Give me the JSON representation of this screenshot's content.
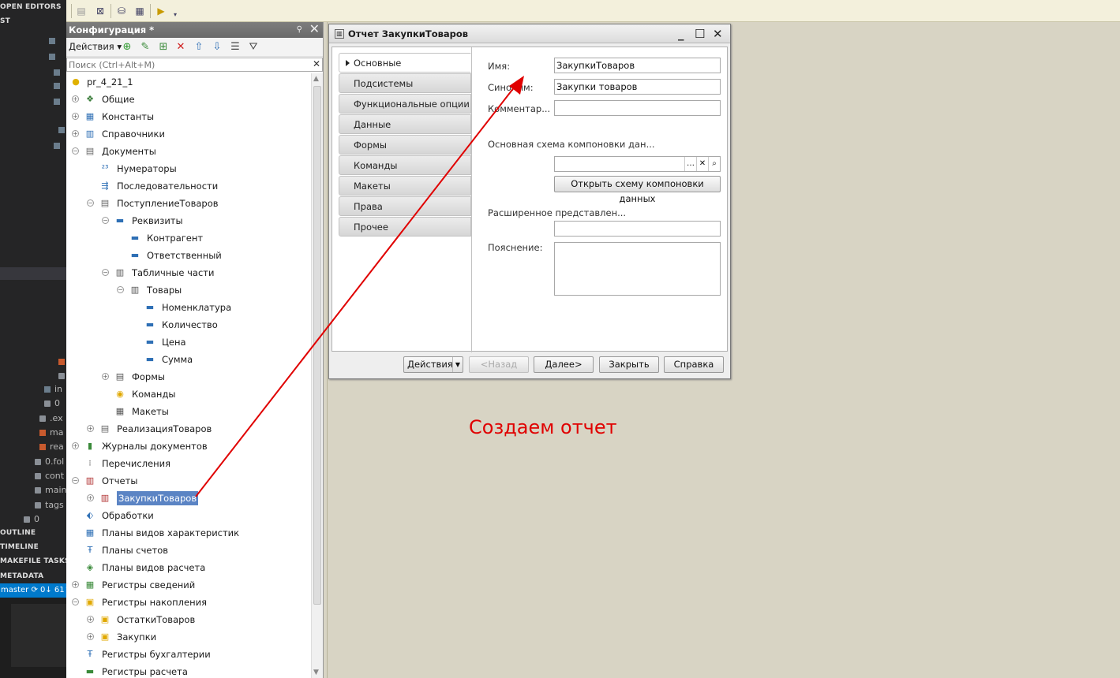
{
  "vscode": {
    "header_open_editors": "OPEN EDITORS",
    "header_st": "ST",
    "files": [
      "in",
      "0",
      ".ex",
      "ma",
      "rea",
      "0.fol",
      "cont",
      "main",
      "tags",
      "0"
    ],
    "outline": "OUTLINE",
    "timeline": "TIMELINE",
    "makefile_tasks": "MAKEFILE TASKS",
    "metadata": "METADATA",
    "status": "master ⟳ 0↓ 61↑"
  },
  "config": {
    "title": "Конфигурация *",
    "actions_label": "Действия ▾",
    "search_placeholder": "Поиск (Ctrl+Alt+M)",
    "tree": [
      {
        "label": "pr_4_21_1",
        "icon": "config-root-icon",
        "glyph": "●",
        "color": "#e0b100"
      },
      {
        "label": "Общие",
        "icon": "common-icon",
        "glyph": "❖",
        "color": "#3a7d3a",
        "exp": "+"
      },
      {
        "label": "Константы",
        "icon": "constants-icon",
        "glyph": "▦",
        "color": "#2e6fb5",
        "exp": "+"
      },
      {
        "label": "Справочники",
        "icon": "catalogs-icon",
        "glyph": "▥",
        "color": "#2e6fb5",
        "exp": "+"
      },
      {
        "label": "Документы",
        "icon": "documents-icon",
        "glyph": "▤",
        "color": "#666",
        "exp": "−"
      },
      {
        "label": "Нумераторы",
        "icon": "numerators-icon",
        "glyph": "²³",
        "color": "#2e6fb5"
      },
      {
        "label": "Последовательности",
        "icon": "sequences-icon",
        "glyph": "⇶",
        "color": "#2e6fb5"
      },
      {
        "label": "ПоступлениеТоваров",
        "icon": "document-icon",
        "glyph": "▤",
        "color": "#666",
        "exp": "−"
      },
      {
        "label": "Реквизиты",
        "icon": "attributes-icon",
        "glyph": "▬",
        "color": "#2e6fb5",
        "exp": "−"
      },
      {
        "label": "Контрагент",
        "icon": "attribute-icon",
        "glyph": "▬",
        "color": "#2e6fb5"
      },
      {
        "label": "Ответственный",
        "icon": "attribute-icon",
        "glyph": "▬",
        "color": "#2e6fb5"
      },
      {
        "label": "Табличные части",
        "icon": "tabular-sections-icon",
        "glyph": "▥",
        "color": "#555",
        "exp": "−"
      },
      {
        "label": "Товары",
        "icon": "tabular-section-icon",
        "glyph": "▥",
        "color": "#555",
        "exp": "−"
      },
      {
        "label": "Номенклатура",
        "icon": "attribute-icon",
        "glyph": "▬",
        "color": "#2e6fb5"
      },
      {
        "label": "Количество",
        "icon": "attribute-icon",
        "glyph": "▬",
        "color": "#2e6fb5"
      },
      {
        "label": "Цена",
        "icon": "attribute-icon",
        "glyph": "▬",
        "color": "#2e6fb5"
      },
      {
        "label": "Сумма",
        "icon": "attribute-icon",
        "glyph": "▬",
        "color": "#2e6fb5"
      },
      {
        "label": "Формы",
        "icon": "forms-icon",
        "glyph": "▤",
        "color": "#555",
        "exp": "+"
      },
      {
        "label": "Команды",
        "icon": "commands-icon",
        "glyph": "◉",
        "color": "#e0a800"
      },
      {
        "label": "Макеты",
        "icon": "templates-icon",
        "glyph": "▦",
        "color": "#555"
      },
      {
        "label": "РеализацияТоваров",
        "icon": "document-icon",
        "glyph": "▤",
        "color": "#666",
        "exp": "+"
      },
      {
        "label": "Журналы документов",
        "icon": "journals-icon",
        "glyph": "▮",
        "color": "#3a8a3a",
        "exp": "+"
      },
      {
        "label": "Перечисления",
        "icon": "enums-icon",
        "glyph": "⁝",
        "color": "#555"
      },
      {
        "label": "Отчеты",
        "icon": "reports-icon",
        "glyph": "▥",
        "color": "#b03030",
        "exp": "−"
      },
      {
        "label": "ЗакупкиТоваров",
        "icon": "report-icon",
        "glyph": "▥",
        "color": "#b03030",
        "exp": "+",
        "selected": true
      },
      {
        "label": "Обработки",
        "icon": "data-processors-icon",
        "glyph": "⬖",
        "color": "#2e6fb5"
      },
      {
        "label": "Планы видов характеристик",
        "icon": "chart-of-characteristics-icon",
        "glyph": "▦",
        "color": "#2e6fb5"
      },
      {
        "label": "Планы счетов",
        "icon": "chart-of-accounts-icon",
        "glyph": "Ŧ",
        "color": "#2e6fb5"
      },
      {
        "label": "Планы видов расчета",
        "icon": "chart-of-calculation-icon",
        "glyph": "◈",
        "color": "#3a8a3a"
      },
      {
        "label": "Регистры сведений",
        "icon": "info-registers-icon",
        "glyph": "▦",
        "color": "#3a8a3a",
        "exp": "+"
      },
      {
        "label": "Регистры накопления",
        "icon": "accumulation-registers-icon",
        "glyph": "▣",
        "color": "#e0a800",
        "exp": "−"
      },
      {
        "label": "ОстаткиТоваров",
        "icon": "accumulation-register-icon",
        "glyph": "▣",
        "color": "#e0a800",
        "exp": "+"
      },
      {
        "label": "Закупки",
        "icon": "accumulation-register-icon",
        "glyph": "▣",
        "color": "#e0a800",
        "exp": "+"
      },
      {
        "label": "Регистры бухгалтерии",
        "icon": "accounting-registers-icon",
        "glyph": "Ŧ",
        "color": "#2e6fb5"
      },
      {
        "label": "Регистры расчета",
        "icon": "calculation-registers-icon",
        "glyph": "▬",
        "color": "#3a8a3a"
      }
    ]
  },
  "dialog": {
    "title": "Отчет ЗакупкиТоваров",
    "tabs": [
      "Основные",
      "Подсистемы",
      "Функциональные опции",
      "Данные",
      "Формы",
      "Команды",
      "Макеты",
      "Права",
      "Прочее"
    ],
    "active_tab": "Основные",
    "fields": {
      "name_label": "Имя:",
      "name_value": "ЗакупкиТоваров",
      "synonym_label": "Синоним:",
      "synonym_value": "Закупки товаров",
      "comment_label": "Комментар...",
      "comment_value": "",
      "schema_label": "Основная схема компоновки дан...",
      "schema_value": "",
      "schema_button": "Открыть схему компоновки данных",
      "extended_label": "Расширенное представлен...",
      "extended_value": "",
      "explanation_label": "Пояснение:",
      "explanation_value": ""
    },
    "buttons": {
      "actions": "Действия",
      "back": "<Назад",
      "next": "Далее>",
      "close": "Закрыть",
      "help": "Справка"
    }
  },
  "annotation": {
    "text": "Создаем отчет",
    "color": "#e00000"
  }
}
